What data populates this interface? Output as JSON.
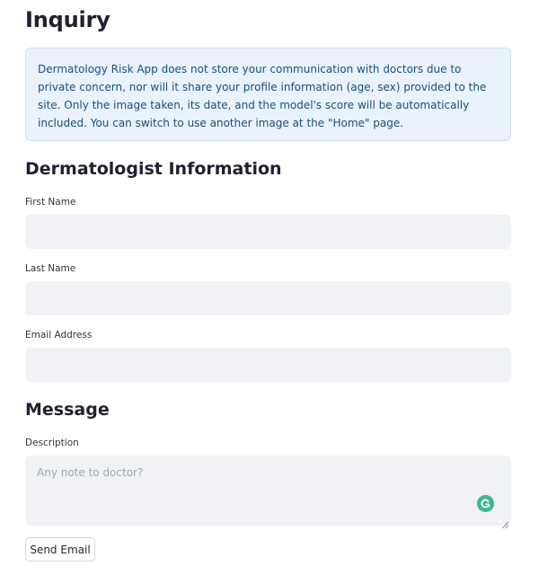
{
  "page": {
    "title": "Inquiry"
  },
  "notice": {
    "text": "Dermatology Risk App does not store your communication with doctors due to private concern, nor will it share your profile information (age, sex) provided to the site. Only the image taken, its date, and the model's score will be automatically included. You can switch to use another image at the \"Home\" page."
  },
  "dermatologist": {
    "heading": "Dermatologist Information",
    "first_name_label": "First Name",
    "first_name_value": "",
    "last_name_label": "Last Name",
    "last_name_value": "",
    "email_label": "Email Address",
    "email_value": ""
  },
  "message": {
    "heading": "Message",
    "description_label": "Description",
    "description_placeholder": "Any note to doctor?",
    "description_value": ""
  },
  "actions": {
    "send_label": "Send Email"
  },
  "colors": {
    "info_background": "#e9f2fd",
    "info_text": "#1b4f7a",
    "input_background": "#f0f2f6",
    "grammarly_green": "#3bb892"
  }
}
